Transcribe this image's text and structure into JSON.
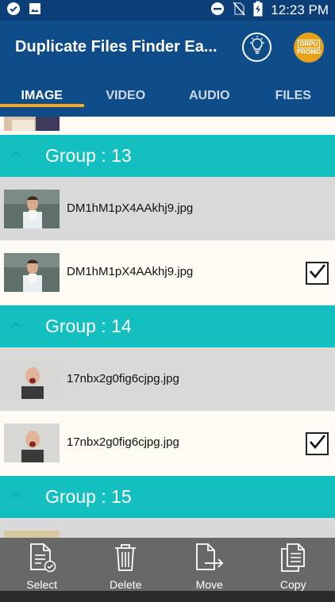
{
  "status_bar": {
    "time": "12:23 PM",
    "left_icons": [
      "check-circle-icon",
      "image-icon"
    ],
    "right_icons": [
      "do-not-disturb-icon",
      "no-sim-icon",
      "battery-charging-icon"
    ]
  },
  "app_bar": {
    "title": "Duplicate Files Finder Ea...",
    "bulb_icon": "lightbulb-icon",
    "promo_line1": "DRPU",
    "promo_line2": "PROMO"
  },
  "tabs": [
    {
      "label": "IMAGE",
      "active": true
    },
    {
      "label": "VIDEO",
      "active": false
    },
    {
      "label": "AUDIO",
      "active": false
    },
    {
      "label": "FILES",
      "active": false
    }
  ],
  "list": {
    "groups": [
      {
        "label": "Group : 13",
        "files": [
          {
            "name": "DM1hM1pX4AAkhj9.jpg",
            "checked": false
          },
          {
            "name": "DM1hM1pX4AAkhj9.jpg",
            "checked": true
          }
        ]
      },
      {
        "label": "Group : 14",
        "files": [
          {
            "name": "17nbx2g0fig6cjpg.jpg",
            "checked": false
          },
          {
            "name": "17nbx2g0fig6cjpg.jpg",
            "checked": true
          }
        ]
      },
      {
        "label": "Group : 15",
        "files": []
      }
    ]
  },
  "toolbar": {
    "select_label": "Select",
    "delete_label": "Delete",
    "move_label": "Move",
    "copy_label": "Copy"
  },
  "colors": {
    "app_bar": "#0e4c8a",
    "status_bar": "#0c3f78",
    "group_header": "#14bfc0",
    "tab_indicator": "#f5a623",
    "promo": "#e8a11a"
  }
}
